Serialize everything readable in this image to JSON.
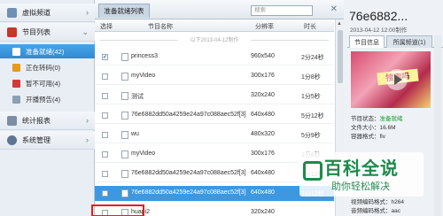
{
  "sidebar": {
    "items": [
      {
        "label": "虚拟频道",
        "arrow": "›"
      },
      {
        "label": "节目列表",
        "arrow": "⌄"
      }
    ],
    "sub_items": [
      {
        "label": "准备就绪(42)",
        "color": "#4a90d9"
      },
      {
        "label": "正在转码(0)",
        "color": "#e89a1a"
      },
      {
        "label": "暂不可用(4)",
        "color": "#d33a3a"
      },
      {
        "label": "开播预告(4)",
        "color": "#8aa0b4"
      }
    ],
    "bottom_items": [
      {
        "label": "统计报表",
        "arrow": "›"
      },
      {
        "label": "系统管理",
        "arrow": "›"
      }
    ]
  },
  "list": {
    "tab_label": "准备就绪列表",
    "search_placeholder": "搜索",
    "columns": {
      "select": "选择",
      "name": "节目名称",
      "resolution": "分辨率",
      "duration": "时长"
    },
    "date_separator": "以下2013-04-12制作",
    "rows": [
      {
        "name": "princess3",
        "resolution": "960x540",
        "duration": "2分24秒",
        "checked": true,
        "selected": false
      },
      {
        "name": "myVideo",
        "resolution": "300x176",
        "duration": "1分8秒",
        "checked": false,
        "selected": false
      },
      {
        "name": "测试",
        "resolution": "320x240",
        "duration": "1分5秒",
        "checked": false,
        "selected": false
      },
      {
        "name": "76e6882dd50a4259e24a97c088aec52f[3]",
        "resolution": "640x480",
        "duration": "5分12秒",
        "checked": false,
        "selected": false
      },
      {
        "name": "wu",
        "resolution": "480x320",
        "duration": "5分9秒",
        "checked": false,
        "selected": false
      },
      {
        "name": "myVideo",
        "resolution": "300x176",
        "duration": "1分8秒",
        "checked": false,
        "selected": false
      },
      {
        "name": "76e6882dd50a4259e24a97c088aec52f[3]",
        "resolution": "640x480",
        "duration": "5分12秒",
        "checked": false,
        "selected": false
      },
      {
        "name": "76e6882dd50a4259e24a97c088aec52f[3]",
        "resolution": "640x480",
        "duration": "5分12秒",
        "checked": false,
        "selected": true
      },
      {
        "name": "huapi2",
        "resolution": "320x240",
        "duration": "",
        "checked": false,
        "selected": false
      }
    ]
  },
  "detail": {
    "title": "76e6882...",
    "date": "2013-04-12 12:00制作",
    "tabs": [
      "节目信息",
      "所属频道(1)"
    ],
    "thumb_text": "搜索吗",
    "status_label": "节目状态：",
    "status_value": "准备就绪",
    "size_label": "文件大小：16.6M",
    "container_label": "容器格式：flv",
    "vcodec_label": "视频编码格式：h264",
    "acodec_label": "音频编码格式：aac"
  },
  "watermark": {
    "line1": "百科全说",
    "line2": "助你轻松解决"
  }
}
